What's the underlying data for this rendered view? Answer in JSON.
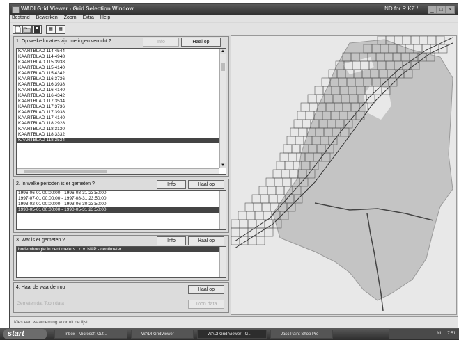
{
  "window": {
    "title": "WADI Grid Viewer - Grid Selection Window",
    "title_right": "ND for RIKZ / ...",
    "btn_min": "_",
    "btn_max": "□",
    "btn_close": "×"
  },
  "menu": [
    "Bestand",
    "Bewerken",
    "Zoom",
    "Extra",
    "Help"
  ],
  "toolbar": {
    "tool_new": "",
    "tool_open": "",
    "tool_save": "",
    "tool_grid1": "▦",
    "tool_grid2": "▦"
  },
  "panel1": {
    "title": "1. Op welke locaties zijn metingen verricht ?",
    "info_label": "Info",
    "fetch_label": "Haal op",
    "items": [
      "KAARTBLAD 114.4544",
      "KAARTBLAD 114.4948",
      "KAARTBLAD 115.3938",
      "KAARTBLAD 115.4140",
      "KAARTBLAD 115.4342",
      "KAARTBLAD 116.3736",
      "KAARTBLAD 116.3938",
      "KAARTBLAD 116.4140",
      "KAARTBLAD 116.4342",
      "KAARTBLAD 117.3534",
      "KAARTBLAD 117.3736",
      "KAARTBLAD 117.3938",
      "KAARTBLAD 117.4140",
      "KAARTBLAD 118.2928",
      "KAARTBLAD 118.3130",
      "KAARTBLAD 118.3332",
      "KAARTBLAD 118.3534"
    ],
    "selected_index": 16
  },
  "panel2": {
    "title": "2. In welke perioden is er gemeten ?",
    "info_label": "Info",
    "fetch_label": "Haal op",
    "items": [
      "1996-06-01 00:00:00 - 1996-08-31 23:50:00",
      "1997-07-01 00:00:00 - 1997-08-31 23:50:00",
      "1993-02-01 00:00:00 - 1993-06-30 23:50:00",
      "1990-05-01 00:00:00 - 1990-05-31 23:50:00"
    ],
    "selected_index": 3
  },
  "panel3": {
    "title": "3. Wat is er gemeten ?",
    "info_label": "Info",
    "fetch_label": "Haal op",
    "items": [
      "bodemhoogte in centimeters t.o.v. NAP - centimeter"
    ],
    "selected_index": 0
  },
  "panel4": {
    "title": "4. Haal de waarden op",
    "fetch_label": "Haal op",
    "fetch_data_label": "Toon data",
    "disabled_text": "Gemeten dat Toon data"
  },
  "status": {
    "text": "Kies een waarneming voor uit de lijst"
  },
  "taskbar": {
    "start_label": "start",
    "tasks": [
      "Inbox - Microsoft Out...",
      "WADI GridViewer",
      "WADI Grid Viewer - G...",
      "Jasc Paint Shop Pro"
    ],
    "active_index": 2,
    "tray_text": "NL",
    "clock": "7:51"
  },
  "colors": {
    "selection": "#444444",
    "map_land": "#c4c4c4",
    "map_water": "#e8e8e8",
    "grid_line": "#555555",
    "titlebar": "#3a3a3a"
  }
}
